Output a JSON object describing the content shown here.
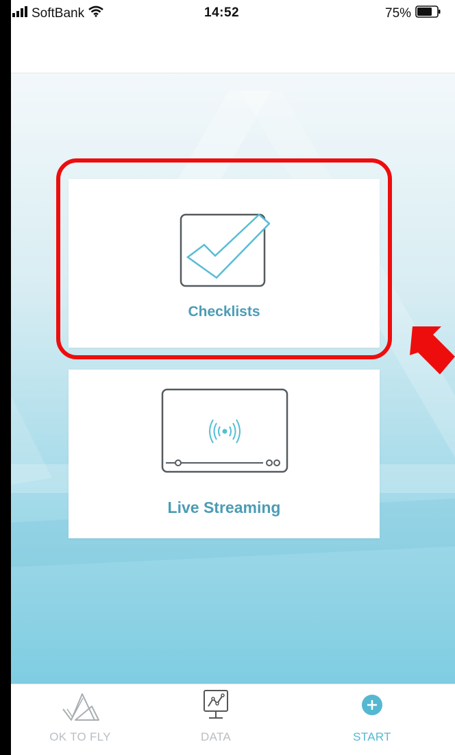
{
  "status_bar": {
    "carrier": "SoftBank",
    "time": "14:52",
    "battery": "75%",
    "battery_level": 0.75
  },
  "cards": {
    "checklists": {
      "label": "Checklists",
      "icon": "checklist-icon"
    },
    "live_streaming": {
      "label": "Live Streaming",
      "icon": "live-stream-icon"
    }
  },
  "tabs": [
    {
      "label": "OK TO FLY",
      "icon": "ok-to-fly-icon",
      "active": false
    },
    {
      "label": "DATA",
      "icon": "data-chart-icon",
      "active": false
    },
    {
      "label": "START",
      "icon": "plus-circle-icon",
      "active": true
    }
  ],
  "colors": {
    "accent": "#55b8d1",
    "label_teal": "#4b9cb5",
    "highlight_red": "#ee0d0d",
    "inactive_tab": "#b9bec2"
  }
}
